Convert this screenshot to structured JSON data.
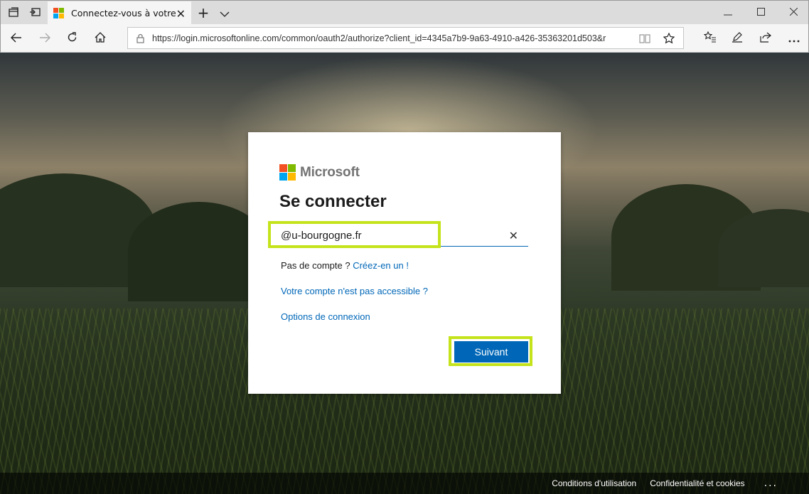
{
  "browser": {
    "tab_title": "Connectez-vous à votre",
    "url": "https://login.microsoftonline.com/common/oauth2/authorize?client_id=4345a7b9-9a63-4910-a426-35363201d503&r"
  },
  "signin": {
    "brand": "Microsoft",
    "heading": "Se connecter",
    "email_value": "@u-bourgogne.fr",
    "no_account_text": "Pas de compte ?",
    "create_link": "Créez-en un !",
    "inaccessible_link": "Votre compte n'est pas accessible ?",
    "options_link": "Options de connexion",
    "next_button": "Suivant"
  },
  "footer": {
    "terms": "Conditions d'utilisation",
    "privacy": "Confidentialité et cookies",
    "more": "..."
  },
  "colors": {
    "accent": "#0067b8",
    "highlight": "#c5e31b"
  }
}
